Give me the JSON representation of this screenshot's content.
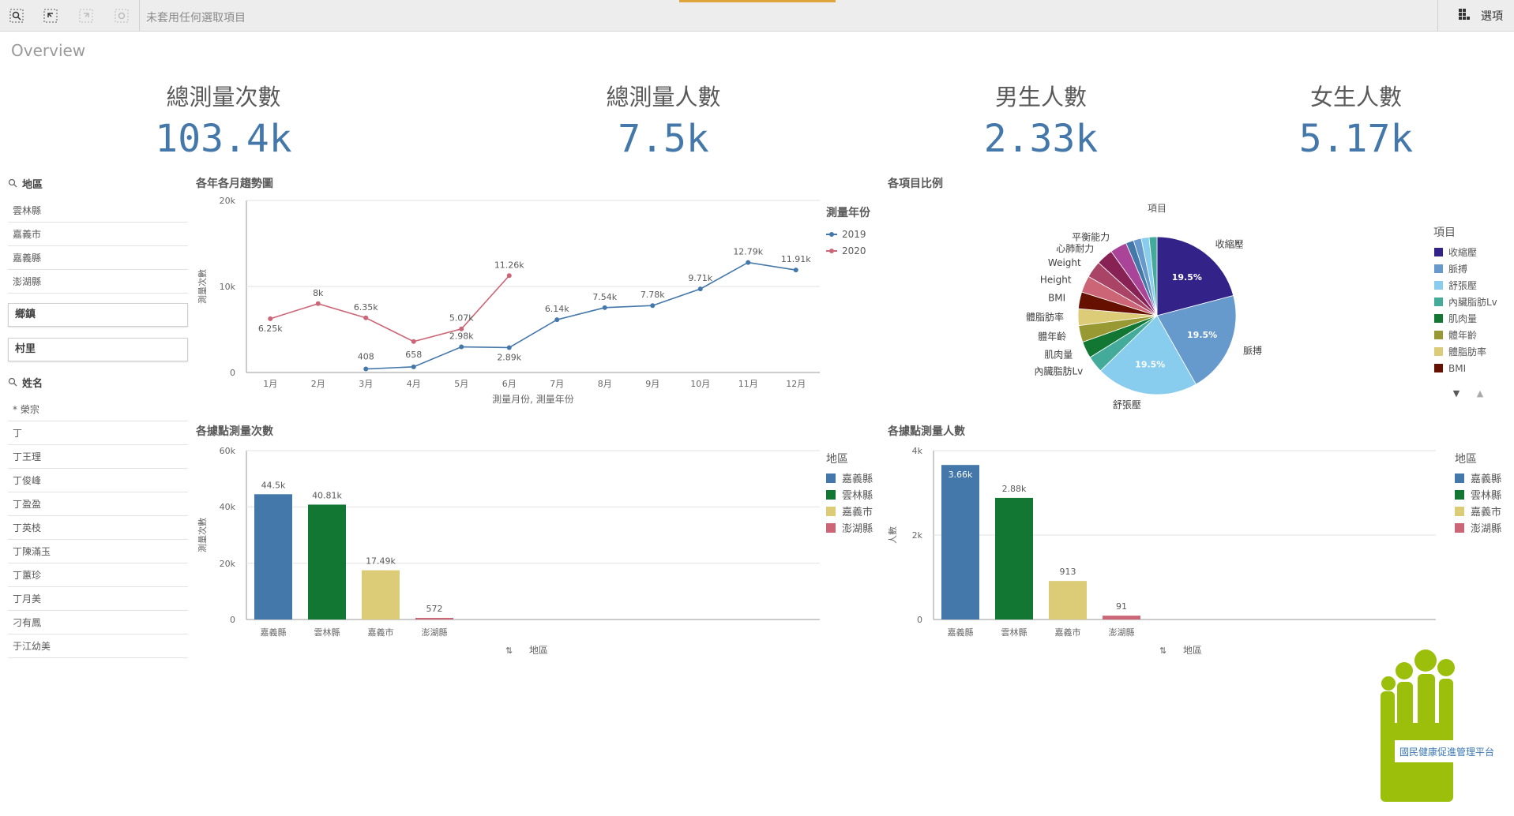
{
  "toolbar": {
    "selection_text": "未套用任何選取項目",
    "options_label": "選項",
    "icons": [
      "smart-search-icon",
      "selections-tool-icon",
      "step-forward-icon",
      "clear-selections-icon",
      "grid-icon"
    ]
  },
  "sheet": {
    "title": "Overview"
  },
  "kpis": [
    {
      "label": "總測量次數",
      "value": "103.4k"
    },
    {
      "label": "總測量人數",
      "value": "7.5k"
    },
    {
      "label": "男生人數",
      "value": "2.33k"
    },
    {
      "label": "女生人數",
      "value": "5.17k"
    }
  ],
  "filters": {
    "region": {
      "label": "地區",
      "items": [
        "雲林縣",
        "嘉義市",
        "嘉義縣",
        "澎湖縣"
      ]
    },
    "township_label": "鄉鎮",
    "village_label": "村里",
    "name": {
      "label": "姓名",
      "items": [
        "* 榮宗",
        "丁",
        "丁王理",
        "丁俊峰",
        "丁盈盈",
        "丁英枝",
        "丁陳滿玉",
        "丁蕙珍",
        "丁月美",
        "刁有鳳",
        "于江幼美"
      ]
    }
  },
  "colors": {
    "blue": "#4477aa",
    "green": "#117733",
    "sand": "#ddcc77",
    "rose": "#cc6677",
    "line2019": "#4477aa",
    "line2020": "#cc6677"
  },
  "charts": {
    "trend": {
      "title": "各年各月趨勢圖",
      "legend_title": "測量年份",
      "ylabel": "測量次數",
      "xlabel": "測量月份, 測量年份",
      "y_ticks": [
        "0",
        "10k",
        "20k"
      ]
    },
    "pie": {
      "title": "各項目比例",
      "top_label": "項目",
      "legend_title": "項目",
      "legend_items": [
        "收縮壓",
        "脈搏",
        "舒張壓",
        "內臟脂肪Lv",
        "肌肉量",
        "體年齡",
        "體脂肪率",
        "BMI"
      ]
    },
    "count_by_site": {
      "title": "各據點測量次數",
      "legend_title": "地區",
      "ylabel": "測量次數",
      "xlabel": "地區",
      "y_ticks": [
        "0",
        "20k",
        "40k",
        "60k"
      ]
    },
    "people_by_site": {
      "title": "各據點測量人數",
      "legend_title": "地區",
      "ylabel": "人數",
      "xlabel": "地區",
      "y_ticks": [
        "0",
        "2k",
        "4k"
      ]
    }
  },
  "logo": {
    "text": "國民健康促進管理平台"
  },
  "chart_data": [
    {
      "type": "line",
      "title": "各年各月趨勢圖",
      "xlabel": "測量月份, 測量年份",
      "ylabel": "測量次數",
      "categories": [
        "1月",
        "2月",
        "3月",
        "4月",
        "5月",
        "6月",
        "7月",
        "8月",
        "9月",
        "10月",
        "11月",
        "12月"
      ],
      "ylim": [
        0,
        20000
      ],
      "series": [
        {
          "name": "2019",
          "values": [
            null,
            null,
            408,
            658,
            2980,
            2890,
            6140,
            7540,
            7780,
            9710,
            12790,
            11910
          ],
          "labels": [
            "",
            "",
            "408",
            "658",
            "2.98k",
            "2.89k",
            "6.14k",
            "7.54k",
            "7.78k",
            "9.71k",
            "12.79k",
            "11.91k"
          ]
        },
        {
          "name": "2020",
          "values": [
            6250,
            8000,
            6350,
            3600,
            5070,
            11260,
            null,
            null,
            null,
            null,
            null,
            null
          ],
          "labels": [
            "6.25k",
            "8k",
            "6.35k",
            "",
            "5.07k",
            "11.26k",
            "",
            "",
            "",
            "",
            "",
            ""
          ]
        }
      ],
      "legend": "right"
    },
    {
      "type": "pie",
      "title": "各項目比例",
      "slices": [
        {
          "label": "收縮壓",
          "value": 19.5,
          "color": "#332288",
          "display": "19.5%"
        },
        {
          "label": "脈搏",
          "value": 19.5,
          "color": "#6699cc",
          "display": "19.5%"
        },
        {
          "label": "舒張壓",
          "value": 19.5,
          "color": "#88ccee",
          "display": "19.5%"
        },
        {
          "label": "內臟脂肪Lv",
          "value": 3.2,
          "color": "#44aa99",
          "display": ""
        },
        {
          "label": "肌肉量",
          "value": 3.2,
          "color": "#117733",
          "display": ""
        },
        {
          "label": "體年齡",
          "value": 3.2,
          "color": "#999933",
          "display": ""
        },
        {
          "label": "體脂肪率",
          "value": 3.2,
          "color": "#ddcc77",
          "display": ""
        },
        {
          "label": "BMI",
          "value": 3.2,
          "color": "#661100",
          "display": ""
        },
        {
          "label": "Height",
          "value": 3.2,
          "color": "#cc6677",
          "display": ""
        },
        {
          "label": "Weight",
          "value": 3.2,
          "color": "#aa4466",
          "display": ""
        },
        {
          "label": "心肺耐力",
          "value": 3.2,
          "color": "#882255",
          "display": ""
        },
        {
          "label": "平衡能力",
          "value": 3.2,
          "color": "#aa4499",
          "display": ""
        },
        {
          "label": "",
          "value": 1.5,
          "color": "#4477aa",
          "display": ""
        },
        {
          "label": "",
          "value": 1.5,
          "color": "#6699cc",
          "display": ""
        },
        {
          "label": "",
          "value": 1.5,
          "color": "#88ccee",
          "display": ""
        },
        {
          "label": "",
          "value": 1.5,
          "color": "#44aa99",
          "display": ""
        }
      ],
      "legend": "right"
    },
    {
      "type": "bar",
      "title": "各據點測量次數",
      "xlabel": "地區",
      "ylabel": "測量次數",
      "categories": [
        "嘉義縣",
        "雲林縣",
        "嘉義市",
        "澎湖縣"
      ],
      "values": [
        44500,
        40810,
        17490,
        572
      ],
      "labels": [
        "44.5k",
        "40.81k",
        "17.49k",
        "572"
      ],
      "ylim": [
        0,
        60000
      ]
    },
    {
      "type": "bar",
      "title": "各據點測量人數",
      "xlabel": "地區",
      "ylabel": "人數",
      "categories": [
        "嘉義縣",
        "雲林縣",
        "嘉義市",
        "澎湖縣"
      ],
      "values": [
        3660,
        2880,
        913,
        91
      ],
      "labels": [
        "3.66k",
        "2.88k",
        "913",
        "91"
      ],
      "ylim": [
        0,
        4000
      ]
    }
  ]
}
